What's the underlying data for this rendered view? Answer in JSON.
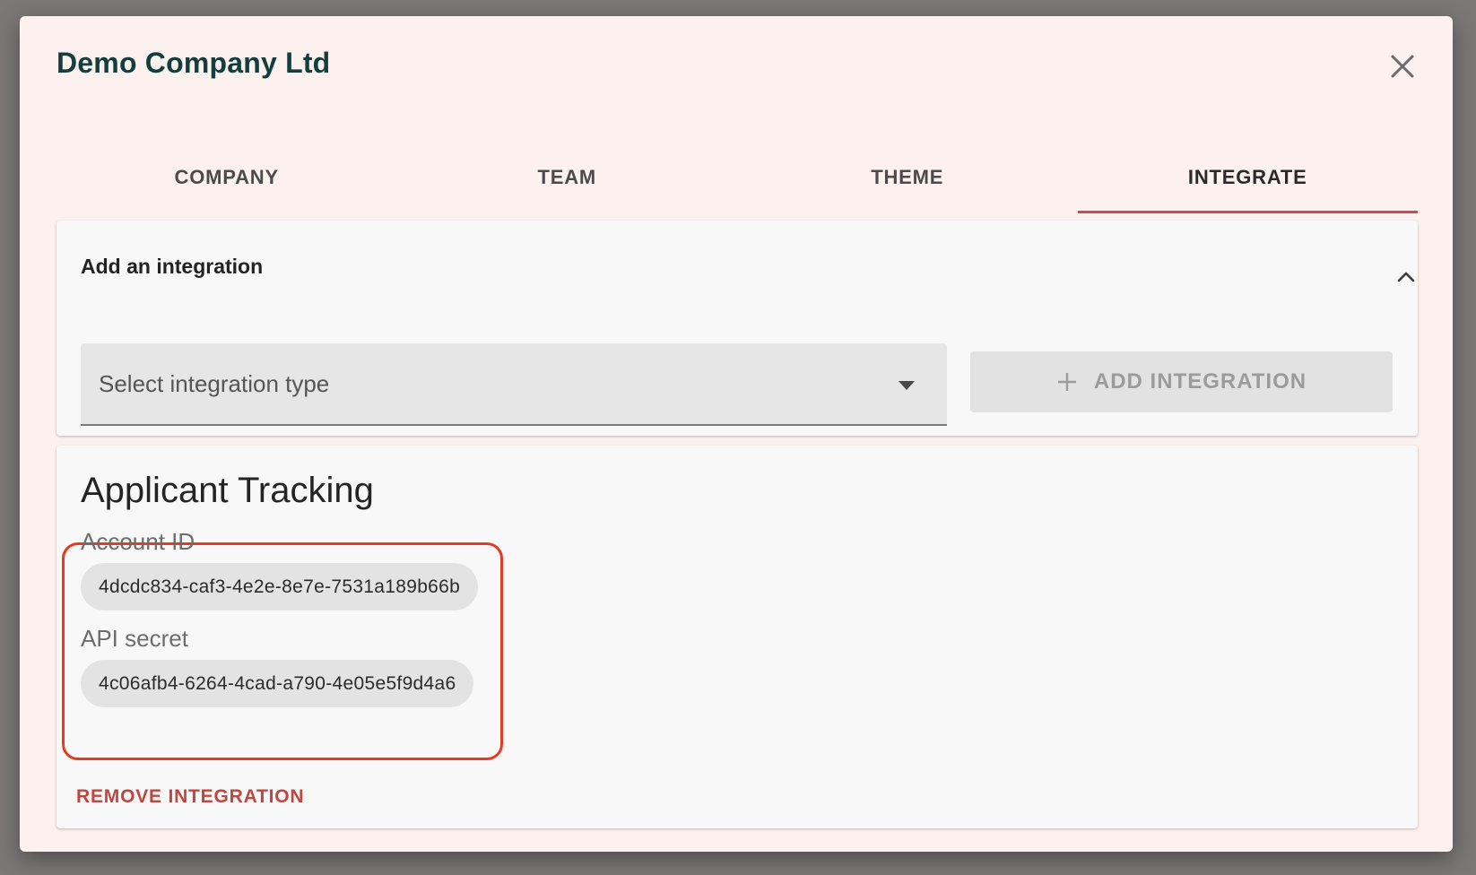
{
  "dialog": {
    "title": "Demo Company Ltd"
  },
  "tabs": [
    {
      "label": "COMPANY",
      "active": false
    },
    {
      "label": "TEAM",
      "active": false
    },
    {
      "label": "THEME",
      "active": false
    },
    {
      "label": "INTEGRATE",
      "active": true
    }
  ],
  "add_integration": {
    "title": "Add an integration",
    "select_placeholder": "Select integration type",
    "button_label": "ADD INTEGRATION",
    "button_enabled": false
  },
  "integration": {
    "title": "Applicant Tracking",
    "account_id_label": "Account ID",
    "account_id_value": "4dcdc834-caf3-4e2e-8e7e-7531a189b66b",
    "api_secret_label": "API secret",
    "api_secret_value": "4c06afb4-6264-4cad-a790-4e05e5f9d4a6",
    "remove_label": "REMOVE INTEGRATION"
  },
  "colors": {
    "accent": "#cd4a4a",
    "highlight": "#e63a22",
    "title": "#143d3d"
  },
  "icons": {
    "close": "close-icon",
    "collapse": "chevron-up-icon",
    "dropdown": "dropdown-caret-icon",
    "add": "plus-icon"
  }
}
